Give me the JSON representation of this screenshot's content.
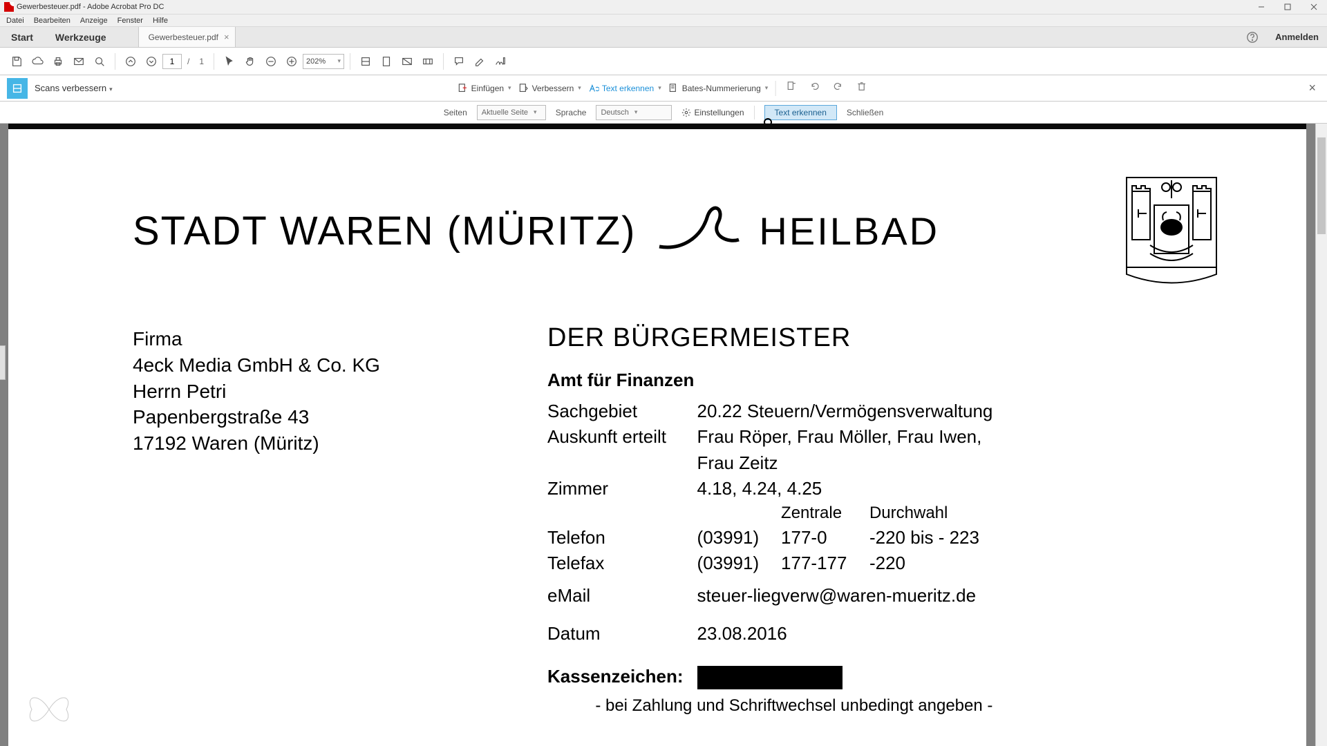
{
  "window": {
    "title": "Gewerbesteuer.pdf - Adobe Acrobat Pro DC"
  },
  "menu": {
    "items": [
      "Datei",
      "Bearbeiten",
      "Anzeige",
      "Fenster",
      "Hilfe"
    ]
  },
  "tabs": {
    "start": "Start",
    "tools": "Werkzeuge",
    "doc": "Gewerbesteuer.pdf",
    "signin": "Anmelden"
  },
  "toolbar": {
    "page_current": "1",
    "page_sep": "/",
    "page_total": "1",
    "zoom": "202%"
  },
  "scanbar": {
    "mode": "Scans verbessern",
    "insert": "Einfügen",
    "enhance": "Verbessern",
    "ocr": "Text erkennen",
    "bates": "Bates-Nummerierung"
  },
  "ocrbar": {
    "pages_label": "Seiten",
    "pages_value": "Aktuelle Seite",
    "lang_label": "Sprache",
    "lang_value": "Deutsch",
    "settings": "Einstellungen",
    "recognize": "Text erkennen",
    "close": "Schließen"
  },
  "doc": {
    "city": "STADT WAREN (MÜRITZ)",
    "heilbad": "HEILBAD",
    "mayor": "DER BÜRGERMEISTER",
    "amt": "Amt für Finanzen",
    "addr": {
      "l1": "Firma",
      "l2": "4eck Media GmbH & Co. KG",
      "l3": "Herrn Petri",
      "l4": "Papenbergstraße 43",
      "l5": "17192 Waren (Müritz)"
    },
    "info": {
      "sachgebiet_l": "Sachgebiet",
      "sachgebiet_v": "20.22  Steuern/Vermögensverwaltung",
      "auskunft_l": "Auskunft erteilt",
      "auskunft_v1": "Frau Röper, Frau Möller, Frau Iwen,",
      "auskunft_v2": "Frau Zeitz",
      "zimmer_l": "Zimmer",
      "zimmer_v": "4.18, 4.24, 4.25",
      "col_zentrale": "Zentrale",
      "col_durchwahl": "Durchwahl",
      "telefon_l": "Telefon",
      "telefon_a": "(03991)",
      "telefon_b": "177-0",
      "telefon_c": "-220 bis - 223",
      "telefax_l": "Telefax",
      "telefax_a": "(03991)",
      "telefax_b": "177-177",
      "telefax_c": "-220",
      "email_l": "eMail",
      "email_v": "steuer-liegverw@waren-mueritz.de",
      "datum_l": "Datum",
      "datum_v": "23.08.2016",
      "kassen_l": "Kassenzeichen:",
      "kassen_foot": "- bei Zahlung und Schriftwechsel unbedingt angeben -"
    }
  }
}
